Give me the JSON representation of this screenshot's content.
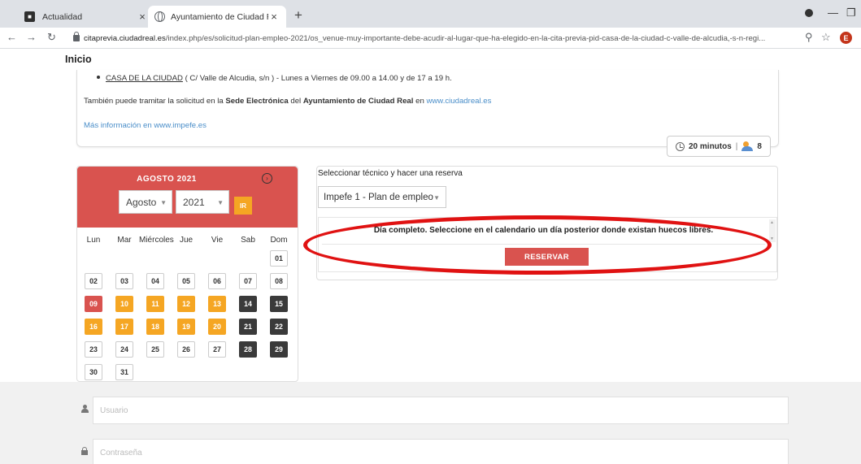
{
  "browser": {
    "tabs": [
      {
        "title": "Actualidad"
      },
      {
        "title": "Ayuntamiento de Ciudad Real"
      }
    ],
    "tab_close": "×",
    "new_tab": "+",
    "url_host": "citaprevia.ciudadreal.es",
    "url_path": "/index.php/es/solicitud-plan-empleo-2021/os_venue-muy-importante-debe-acudir-al-lugar-que-ha-elegido-en-la-cita-previa-pid-casa-de-la-ciudad-c-valle-de-alcudia,-s-n-regi...",
    "profile_initial": "E"
  },
  "page": {
    "title": "Inicio",
    "info": {
      "bullet_link": "CASA DE LA CIUDAD",
      "bullet_text": " ( C/ Valle de Alcudia, s/n ) - Lunes a Viernes de 09.00 a 14.00 y de 17 a 19 h.",
      "line2_a": "También puede tramitar la solicitud en la ",
      "line2_b": "Sede Electrónica",
      "line2_c": " del ",
      "line2_d": "Ayuntamiento de Ciudad Real",
      "line2_e": " en ",
      "line2_link": "www.ciudadreal.es",
      "line3": "Más información en www.impefe.es"
    },
    "badge": {
      "duration": "20 minutos",
      "sep": "|",
      "count": "8"
    }
  },
  "calendar": {
    "title": "AGOSTO 2021",
    "next": "›",
    "month_value": "Agosto",
    "year_value": "2021",
    "go_label": "IR",
    "weekdays": [
      "Lun",
      "Mar",
      "Miércoles",
      "Jue",
      "Vie",
      "Sab",
      "Dom"
    ],
    "weeks": [
      [
        null,
        null,
        null,
        null,
        null,
        null,
        {
          "d": "01",
          "s": "plain"
        }
      ],
      [
        {
          "d": "02",
          "s": "plain"
        },
        {
          "d": "03",
          "s": "plain"
        },
        {
          "d": "04",
          "s": "plain"
        },
        {
          "d": "05",
          "s": "plain"
        },
        {
          "d": "06",
          "s": "plain"
        },
        {
          "d": "07",
          "s": "plain"
        },
        {
          "d": "08",
          "s": "plain"
        }
      ],
      [
        {
          "d": "09",
          "s": "red"
        },
        {
          "d": "10",
          "s": "orange"
        },
        {
          "d": "11",
          "s": "orange"
        },
        {
          "d": "12",
          "s": "orange"
        },
        {
          "d": "13",
          "s": "orange"
        },
        {
          "d": "14",
          "s": "dark"
        },
        {
          "d": "15",
          "s": "dark"
        }
      ],
      [
        {
          "d": "16",
          "s": "orange"
        },
        {
          "d": "17",
          "s": "orange"
        },
        {
          "d": "18",
          "s": "orange"
        },
        {
          "d": "19",
          "s": "orange"
        },
        {
          "d": "20",
          "s": "orange"
        },
        {
          "d": "21",
          "s": "dark"
        },
        {
          "d": "22",
          "s": "dark"
        }
      ],
      [
        {
          "d": "23",
          "s": "plain"
        },
        {
          "d": "24",
          "s": "plain"
        },
        {
          "d": "25",
          "s": "plain"
        },
        {
          "d": "26",
          "s": "plain"
        },
        {
          "d": "27",
          "s": "plain"
        },
        {
          "d": "28",
          "s": "dark"
        },
        {
          "d": "29",
          "s": "dark"
        }
      ],
      [
        {
          "d": "30",
          "s": "plain"
        },
        {
          "d": "31",
          "s": "plain"
        },
        null,
        null,
        null,
        null,
        null
      ]
    ]
  },
  "reservation": {
    "heading": "Seleccionar técnico y hacer una reserva",
    "technician": "Impefe 1 - Plan de empleo",
    "message": "Día completo. Seleccione en el calendario un día posterior donde existan huecos libres.",
    "button": "RESERVAR"
  },
  "login": {
    "user_placeholder": "Usuario",
    "password_placeholder": "Contraseña"
  },
  "colors": {
    "primary_red": "#d9534f",
    "orange": "#f5a623",
    "dark_day": "#3a3a3a",
    "annotation_red": "#e01212"
  },
  "icons": [
    "actualidad-favicon",
    "globe-icon",
    "lock-icon",
    "zoom-icon",
    "star-icon",
    "clock-icon",
    "users-icon",
    "chevron-right-icon",
    "user-icon",
    "padlock-icon"
  ]
}
